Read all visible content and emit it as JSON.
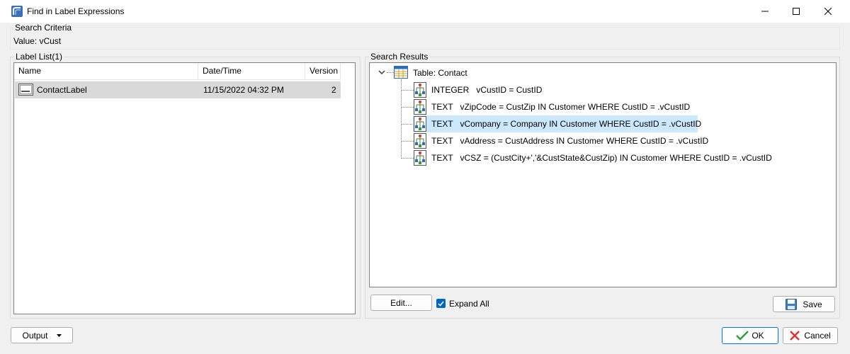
{
  "window": {
    "title": "Find in Label Expressions"
  },
  "search_criteria": {
    "legend": "Search Criteria",
    "value_text": "Value: vCust"
  },
  "label_list": {
    "legend": "Label List(1)",
    "columns": [
      "Name",
      "Date/Time",
      "Version"
    ],
    "rows": [
      {
        "name": "ContactLabel",
        "datetime": "11/15/2022 04:32 PM",
        "version": "2"
      }
    ]
  },
  "search_results": {
    "legend": "Search Results",
    "table_node": "Table: Contact",
    "items": [
      {
        "text": "INTEGER   vCustID = CustID"
      },
      {
        "text": "TEXT   vZipCode = CustZip IN Customer WHERE CustID = .vCustID"
      },
      {
        "text": "TEXT   vCompany = Company IN Customer WHERE CustID = .vCustID"
      },
      {
        "text": "TEXT   vAddress = CustAddress IN Customer WHERE CustID = .vCustID"
      },
      {
        "text": "TEXT   vCSZ = (CustCity+','&CustState&CustZip) IN Customer WHERE CustID = .vCustID"
      }
    ],
    "selected_index": 2
  },
  "buttons": {
    "edit": "Edit...",
    "expand_all": "Expand All",
    "expand_all_checked": true,
    "save": "Save",
    "output": "Output",
    "ok": "OK",
    "cancel": "Cancel"
  },
  "colors": {
    "selection": "#cce8ff",
    "row_selection": "#d9d9d9",
    "accent": "#0078d7",
    "cancel_red": "#d9342b",
    "ok_green": "#2e9b3a"
  }
}
